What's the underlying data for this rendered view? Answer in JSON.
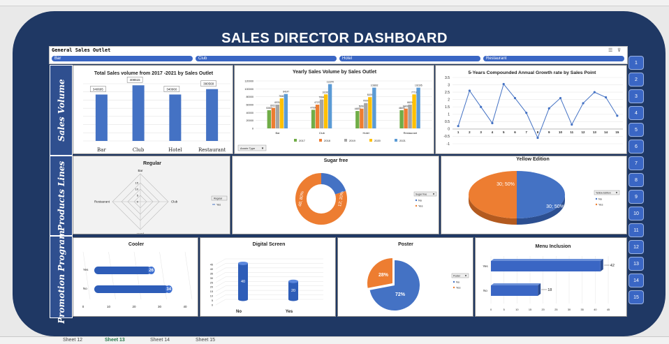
{
  "dashboard": {
    "title": "SALES DIRECTOR DASHBOARD",
    "slicer_title": "General Sales Outlet",
    "slicer_items": [
      "Bar",
      "Club",
      "Hotel",
      "Restaurant"
    ],
    "section_labels": [
      "Sales Volume",
      "Products Lines",
      "Promotion Program"
    ],
    "index_buttons": [
      "1",
      "2",
      "3",
      "4",
      "5",
      "6",
      "7",
      "8",
      "9",
      "10",
      "11",
      "12",
      "13",
      "14",
      "15"
    ]
  },
  "colors": {
    "frame": "#1f3864",
    "bar_blue": "#4472c4",
    "orange": "#ed7d31",
    "green": "#70ad47",
    "gray": "#a5a5a5",
    "yellow": "#ffc000",
    "light_blue": "#5b9bd5"
  },
  "chart_data": [
    {
      "id": "total",
      "type": "bar",
      "title": "Total Sales volume  from 2017 -2021 by Sales Outlet",
      "categories": [
        "Bar",
        "Club",
        "Hotel",
        "Restaurant"
      ],
      "values": [
        340695,
        408515,
        340960,
        380568
      ],
      "labels": [
        "340695",
        "408515",
        "340960",
        "380568"
      ],
      "ylim": [
        0,
        420000
      ]
    },
    {
      "id": "yearly",
      "type": "bar",
      "title": "Yearly Sales Volume by  Sales Outlet",
      "categories": [
        "Bar",
        "Club",
        "Hotel",
        "Restaurant"
      ],
      "yticks": [
        "0",
        "20000",
        "40000",
        "60000",
        "80000",
        "100000",
        "120000"
      ],
      "ylim": [
        0,
        120000
      ],
      "series": [
        {
          "name": "2017",
          "values": [
            46000,
            47000,
            44000,
            46000
          ]
        },
        {
          "name": "2018",
          "values": [
            52000,
            60000,
            50000,
            50000
          ]
        },
        {
          "name": "2019",
          "values": [
            60000,
            73000,
            64000,
            60000
          ]
        },
        {
          "name": "2020",
          "values": [
            76000,
            86000,
            79000,
            86000
          ]
        },
        {
          "name": "2021",
          "values": [
            87000,
            112000,
            103000,
            103000
          ]
        }
      ],
      "bar_labels": [
        [
          "53000",
          "60121",
          "69760",
          "75000",
          "84147"
        ],
        [
          "47000",
          "67270",
          "79646",
          "102000",
          "112370"
        ],
        [
          "44800",
          "50567",
          "70000",
          "81000",
          "103802"
        ],
        [
          "46000",
          "64000",
          "66226",
          "77710",
          "102195"
        ]
      ],
      "filter_label": "Année Type"
    },
    {
      "id": "cagr",
      "type": "line",
      "title": "5-Years Compounded Annual Growth rate by  Sales Point",
      "x": [
        1,
        2,
        3,
        4,
        5,
        6,
        7,
        8,
        9,
        10,
        11,
        12,
        13,
        14,
        15
      ],
      "y": [
        0.2,
        2.6,
        1.5,
        0.4,
        3.05,
        2.1,
        1.1,
        -0.6,
        1.4,
        2.1,
        0.3,
        1.75,
        2.5,
        2.15,
        0.9
      ],
      "yticks": [
        "-1",
        "-0.5",
        "0",
        "0.5",
        "1",
        "1.5",
        "2",
        "2.5",
        "3",
        "3.5"
      ],
      "ylim": [
        -1,
        3.5
      ]
    },
    {
      "id": "regular",
      "type": "radar",
      "title": "Regular",
      "axes": [
        "Bar",
        "Club",
        "Hotel",
        "Restaurant"
      ],
      "rticks": [
        "0",
        "5",
        "10",
        "15"
      ],
      "legend_title": "Regular",
      "legend_items": [
        "Yes"
      ]
    },
    {
      "id": "sugar",
      "type": "pie",
      "title": "Sugar free",
      "values": [
        48,
        12
      ],
      "labels": [
        "48; 80%",
        "12; 20%"
      ],
      "series_names": [
        "Yes",
        "No"
      ],
      "legend_title": "Sugar free",
      "legend_items": [
        "No",
        "Yes"
      ]
    },
    {
      "id": "yellow",
      "type": "pie",
      "title": "Yellow Edition",
      "values": [
        30,
        30
      ],
      "labels": [
        "30; 50%",
        "30; 50%"
      ],
      "legend_title": "Yellow Edition",
      "legend_items": [
        "No",
        "Yes"
      ]
    },
    {
      "id": "cooler",
      "type": "bar",
      "title": "Cooler",
      "categories": [
        "Yes",
        "No"
      ],
      "values": [
        26,
        34
      ],
      "xticks": [
        "0",
        "10",
        "20",
        "30",
        "40"
      ],
      "xlim": [
        0,
        40
      ]
    },
    {
      "id": "digital",
      "type": "bar",
      "title": "Digital Screen",
      "categories": [
        "No",
        "Yes"
      ],
      "values": [
        40,
        20
      ],
      "yticks": [
        "0",
        "5",
        "10",
        "15",
        "20",
        "25",
        "30",
        "35",
        "40",
        "45"
      ],
      "ylim": [
        0,
        45
      ]
    },
    {
      "id": "poster",
      "type": "pie",
      "title": "Poster",
      "values": [
        72,
        28
      ],
      "labels": [
        "72%",
        "28%"
      ],
      "legend_title": "Poster",
      "legend_items": [
        "No",
        "Yes"
      ]
    },
    {
      "id": "menu",
      "type": "bar",
      "title": "Menu Inclusion",
      "categories": [
        "Yes",
        "No"
      ],
      "values": [
        42,
        18
      ],
      "xticks": [
        "0",
        "5",
        "10",
        "15",
        "20",
        "25",
        "30",
        "35",
        "40",
        "45"
      ],
      "xlim": [
        0,
        45
      ]
    }
  ],
  "sheet_tabs": [
    "Sheet 12",
    "Sheet 13",
    "Sheet 14",
    "Sheet 15"
  ]
}
